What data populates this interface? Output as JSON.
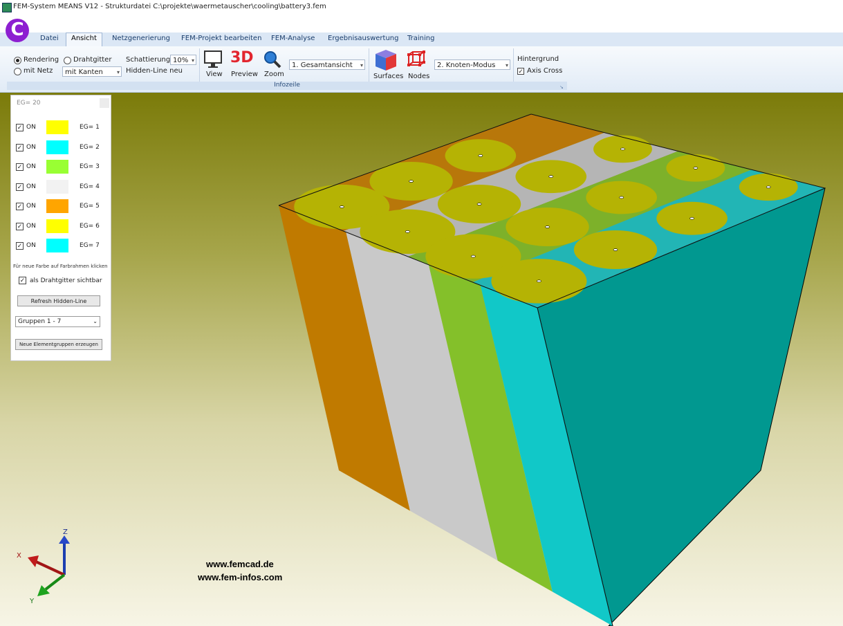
{
  "window": {
    "title": "FEM-System MEANS V12 - Strukturdatei  C:\\projekte\\waermetauscher\\cooling\\battery3.fem"
  },
  "quick_access": {
    "logo_letter": "C"
  },
  "tabs": [
    "Datei",
    "Ansicht",
    "Netzgenerierung",
    "FEM-Projekt bearbeiten",
    "FEM-Analyse",
    "Ergebnisauswertung",
    "Training"
  ],
  "active_tab": "Ansicht",
  "ribbon": {
    "rendering": "Rendering",
    "drahtgitter": "Drahtgitter",
    "mit_netz": "mit Netz",
    "kanten_combo": "mit Kanten",
    "schattierung_label": "Schattierung:",
    "schattierung_value": "10%",
    "hidden_line": "Hidden-Line neu",
    "view": "View",
    "preview": "Preview",
    "preview_icon_text": "3D",
    "zoom": "Zoom",
    "ansicht_combo": "1.  Gesamtansicht",
    "surfaces": "Surfaces",
    "nodes": "Nodes",
    "modus_combo": "2.  Knoten-Modus",
    "hintergrund": "Hintergrund",
    "axis_cross": "Axis Cross",
    "group_label": "Infozeile"
  },
  "panel": {
    "eg_count": "EG=  20",
    "groups": [
      {
        "on": "ON",
        "label": "EG= 1",
        "color": "#ffff00"
      },
      {
        "on": "ON",
        "label": "EG= 2",
        "color": "#00ffff"
      },
      {
        "on": "ON",
        "label": "EG= 3",
        "color": "#99ff33"
      },
      {
        "on": "ON",
        "label": "EG= 4",
        "color": "#f2f2f2"
      },
      {
        "on": "ON",
        "label": "EG= 5",
        "color": "#ffa500"
      },
      {
        "on": "ON",
        "label": "EG= 6",
        "color": "#ffff00"
      },
      {
        "on": "ON",
        "label": "EG= 7",
        "color": "#00ffff"
      }
    ],
    "hint": "Für neue Farbe auf Farbrahmen klicken",
    "wireframe_visible": "als Drahtgitter sichtbar",
    "refresh_button": "Refresh Hidden-Line",
    "gruppen_select": "Gruppen  1 - 7",
    "new_groups_button": "Neue Elementgruppen erzeugen"
  },
  "axes": {
    "x": "X",
    "y": "Y",
    "z": "Z"
  },
  "watermark": [
    "www.femcad.de",
    "www.fem-infos.com"
  ],
  "colors": {
    "orange_side": "#c07a00",
    "orange_top": "#b8770a",
    "gray_side": "#c9c9c9",
    "gray_top": "#b5b5b5",
    "green_side": "#84c02a",
    "green_top": "#7db12a",
    "cyan_side": "#11c8c8",
    "cyan_top": "#22b5b5",
    "right_face": "#019890",
    "cell": "#b5b304"
  }
}
